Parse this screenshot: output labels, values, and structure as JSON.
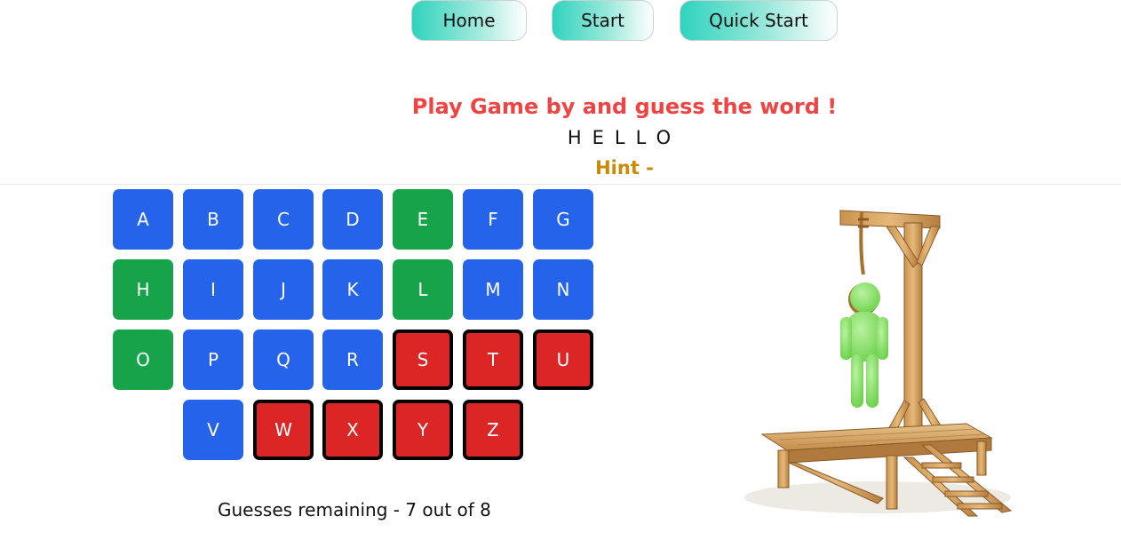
{
  "nav": {
    "home_label": "Home",
    "start_label": "Start",
    "quick_start_label": "Quick Start"
  },
  "game": {
    "title": "Play Game by and guess the word !",
    "word_display": "HELLO",
    "hint_label": "Hint -",
    "guesses_remaining_text": "Guesses remaining - 7 out of 8",
    "guesses_remaining": 7,
    "guesses_total": 8
  },
  "keyboard": {
    "rows": [
      [
        {
          "letter": "A",
          "state": "unused"
        },
        {
          "letter": "B",
          "state": "unused"
        },
        {
          "letter": "C",
          "state": "unused"
        },
        {
          "letter": "D",
          "state": "unused"
        },
        {
          "letter": "E",
          "state": "correct"
        },
        {
          "letter": "F",
          "state": "unused"
        },
        {
          "letter": "G",
          "state": "unused"
        }
      ],
      [
        {
          "letter": "H",
          "state": "correct"
        },
        {
          "letter": "I",
          "state": "unused"
        },
        {
          "letter": "J",
          "state": "unused"
        },
        {
          "letter": "K",
          "state": "unused"
        },
        {
          "letter": "L",
          "state": "correct"
        },
        {
          "letter": "M",
          "state": "unused"
        },
        {
          "letter": "N",
          "state": "unused"
        }
      ],
      [
        {
          "letter": "O",
          "state": "correct"
        },
        {
          "letter": "P",
          "state": "unused"
        },
        {
          "letter": "Q",
          "state": "unused"
        },
        {
          "letter": "R",
          "state": "unused"
        },
        {
          "letter": "S",
          "state": "wrong"
        },
        {
          "letter": "T",
          "state": "wrong"
        },
        {
          "letter": "U",
          "state": "wrong"
        }
      ],
      [
        {
          "letter": "V",
          "state": "unused"
        },
        {
          "letter": "W",
          "state": "wrong"
        },
        {
          "letter": "X",
          "state": "wrong"
        },
        {
          "letter": "Y",
          "state": "wrong"
        },
        {
          "letter": "Z",
          "state": "wrong"
        }
      ]
    ]
  },
  "colors": {
    "unused": "#2563eb",
    "correct": "#16a34a",
    "wrong": "#dc2626",
    "title": "#ef4444",
    "hint": "#ca8a04"
  },
  "illustration": {
    "icon": "hangman-gallows-icon"
  }
}
